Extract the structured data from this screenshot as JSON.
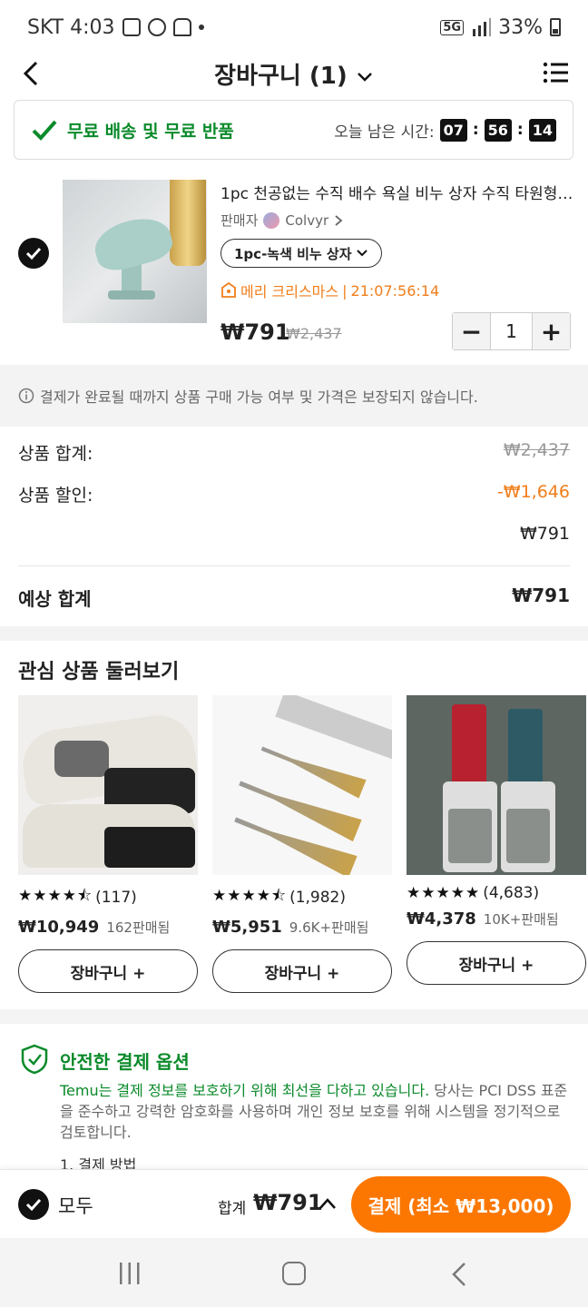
{
  "status_bar": {
    "carrier_time": "SKT 4:03",
    "network": "5G",
    "battery": "33%"
  },
  "header": {
    "title": "장바구니 (1)"
  },
  "promo": {
    "shipping": "무료 배송 및 무료 반품",
    "time_left_label": "오늘 남은 시간:",
    "timer": [
      "07",
      "56",
      "14"
    ]
  },
  "cart_item": {
    "title": "1pc 천공없는 수직 배수 욕실 비누 상자 수직 타원형 비누 접시",
    "seller_label": "판매자",
    "seller_name": "Colvyr",
    "variant": "1pc-녹색 비누 상자",
    "promo_text": "메리 크리스마스",
    "promo_timer": "21:07:56:14",
    "price": "₩791",
    "original_price": "₩2,437",
    "quantity": "1"
  },
  "notice": "결제가 완료될 때까지 상품 구매 가능 여부 및 가격은 보장되지 않습니다.",
  "summary": {
    "subtotal_label": "상품 합계:",
    "subtotal_value": "₩2,437",
    "discount_label": "상품 할인:",
    "discount_value": "-₩1,646",
    "after_discount": "₩791",
    "estimated_label": "예상 합계",
    "estimated_value": "₩791"
  },
  "recommendations": {
    "title": "관심 상품 둘러보기",
    "items": [
      {
        "rating": "4.5",
        "reviews": "(117)",
        "price": "₩10,949",
        "sold": "162판매됨",
        "button": "장바구니 +"
      },
      {
        "rating": "4.5",
        "reviews": "(1,982)",
        "price": "₩5,951",
        "sold": "9.6K+판매됨",
        "button": "장바구니 +"
      },
      {
        "rating": "4.8",
        "reviews": "(4,683)",
        "price": "₩4,378",
        "sold": "10K+판매됨",
        "button": "장바구니 +"
      }
    ]
  },
  "secure": {
    "title": "안전한 결제 옵션",
    "text_green": "Temu는 결제 정보를 보호하기 위해 최선을 다하고 있습니다.",
    "text_rest": " 당사는 PCI DSS 표준을 준수하고 강력한 암호화를 사용하며 개인 정보 보호를 위해 시스템을 정기적으로 검토합니다.",
    "sub": "1. 결제 방법"
  },
  "bottom_bar": {
    "all_label": "모두",
    "total_label": "합계",
    "total_value": "₩791",
    "checkout": "결제 (최소 ₩13,000)"
  },
  "colors": {
    "accent_orange": "#fb7701",
    "green": "#0a8a2a",
    "promo_orange": "#f07e1b"
  }
}
